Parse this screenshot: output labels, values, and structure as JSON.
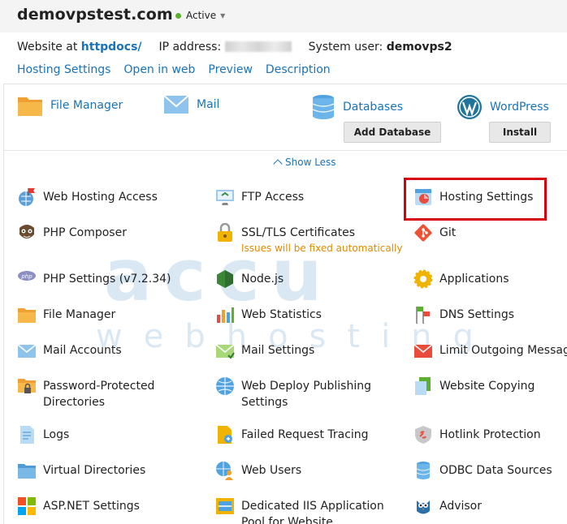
{
  "header": {
    "domain": "demovpstest.com",
    "status": "Active",
    "status_color": "#5cb030"
  },
  "info": {
    "website_label": "Website at",
    "website_path": "httpdocs/",
    "ip_label": "IP address:",
    "user_label": "System user:",
    "user_value": "demovps2"
  },
  "links": [
    "Hosting Settings",
    "Open in web",
    "Preview",
    "Description"
  ],
  "quick": {
    "file_manager": "File Manager",
    "mail": "Mail",
    "databases": "Databases",
    "add_database": "Add Database",
    "wordpress": "WordPress",
    "install": "Install"
  },
  "show_less": "Show Less",
  "tools": {
    "web_hosting_access": "Web Hosting Access",
    "ftp_access": "FTP Access",
    "hosting_settings": "Hosting Settings",
    "php_composer": "PHP Composer",
    "ssl_tls": "SSL/TLS Certificates",
    "ssl_note": "Issues will be fixed automatically",
    "git": "Git",
    "php_settings": "PHP Settings (v7.2.34)",
    "nodejs": "Node.js",
    "applications": "Applications",
    "file_manager": "File Manager",
    "web_statistics": "Web Statistics",
    "dns_settings": "DNS Settings",
    "mail_accounts": "Mail Accounts",
    "mail_settings": "Mail Settings",
    "limit_outgoing": "Limit Outgoing Message",
    "password_protected_1": "Password-Protected",
    "password_protected_2": "Directories",
    "web_deploy_1": "Web Deploy Publishing",
    "web_deploy_2": "Settings",
    "website_copying": "Website Copying",
    "logs": "Logs",
    "failed_request": "Failed Request Tracing",
    "hotlink": "Hotlink Protection",
    "virtual_dirs": "Virtual Directories",
    "web_users": "Web Users",
    "odbc": "ODBC Data Sources",
    "aspnet": "ASP.NET Settings",
    "iis_pool_1": "Dedicated IIS Application",
    "iis_pool_2": "Pool for Website",
    "advisor": "Advisor"
  },
  "colors": {
    "link": "#1a73b8",
    "highlight": "#d9000d",
    "warning": "#e08a00"
  }
}
